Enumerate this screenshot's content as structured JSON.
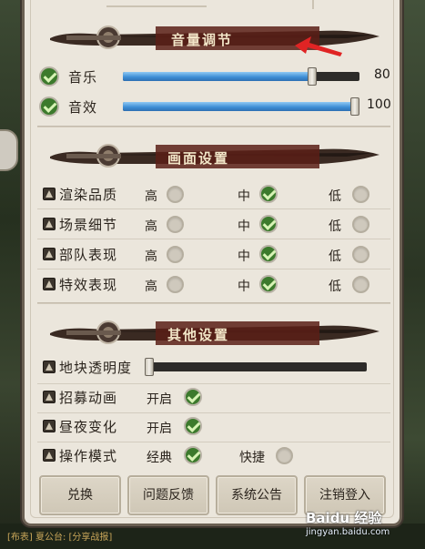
{
  "sections": {
    "volume": {
      "title": "音量调节"
    },
    "graphics": {
      "title": "画面设置"
    },
    "other": {
      "title": "其他设置"
    }
  },
  "volume": {
    "music": {
      "label": "音乐",
      "enabled": true,
      "value": 80,
      "value_text": "80"
    },
    "sfx": {
      "label": "音效",
      "enabled": true,
      "value": 100,
      "value_text": "100"
    }
  },
  "graphics": {
    "options": {
      "high": "高",
      "mid": "中",
      "low": "低"
    },
    "rows": [
      {
        "label": "渲染品质",
        "selected": "mid"
      },
      {
        "label": "场景细节",
        "selected": "mid"
      },
      {
        "label": "部队表现",
        "selected": "mid"
      },
      {
        "label": "特效表现",
        "selected": "mid"
      }
    ]
  },
  "other": {
    "tile_transparency": {
      "label": "地块透明度",
      "value": 0
    },
    "recruit_anim": {
      "label": "招募动画",
      "option": "开启",
      "checked": true
    },
    "day_night": {
      "label": "昼夜变化",
      "option": "开启",
      "checked": true
    },
    "control_mode": {
      "label": "操作模式",
      "options": [
        "经典",
        "快捷"
      ],
      "selected": "经典"
    }
  },
  "buttons": {
    "redeem": "兑换",
    "feedback": "问题反馈",
    "announcement": "系统公告",
    "logout": "注销登入"
  },
  "watermark": {
    "brand": "Baidu 经验",
    "url": "jingyan.baidu.com"
  },
  "bottom_ticker": "[布表] 夏公台: [分享战报]",
  "colors": {
    "panel": "#ebe6dc",
    "check_green": "#3c7a2c",
    "slider_fill": "#3f8fd6",
    "arrow_red": "#e02424"
  }
}
